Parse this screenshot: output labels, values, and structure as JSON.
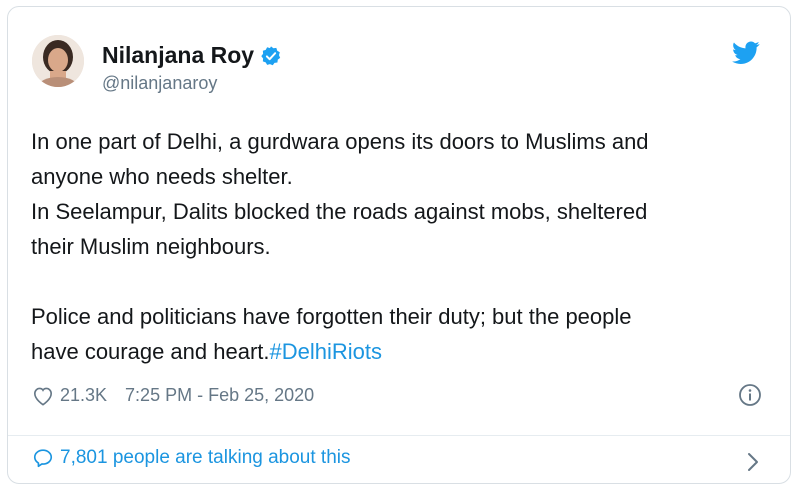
{
  "author": {
    "display_name": "Nilanjana Roy",
    "handle": "@nilanjanaroy",
    "verified_icon": "verified-badge-icon",
    "brand_color": "#1da1f2"
  },
  "tweet": {
    "paragraph1": [
      "In one part of Delhi, a gurdwara opens its doors to Muslims and",
      "anyone who needs shelter.",
      "In Seelampur, Dalits blocked the roads against mobs, sheltered",
      "their Muslim neighbours."
    ],
    "paragraph2": [
      "Police and politicians have forgotten their duty; but the people",
      "have courage and heart."
    ],
    "hashtag": "#DelhiRiots",
    "hashtag_color": "#1b95e0"
  },
  "meta": {
    "likes": "21.3K",
    "timestamp": "7:25 PM - Feb 25, 2020"
  },
  "footer": {
    "talking_text": "7,801 people are talking about this"
  }
}
